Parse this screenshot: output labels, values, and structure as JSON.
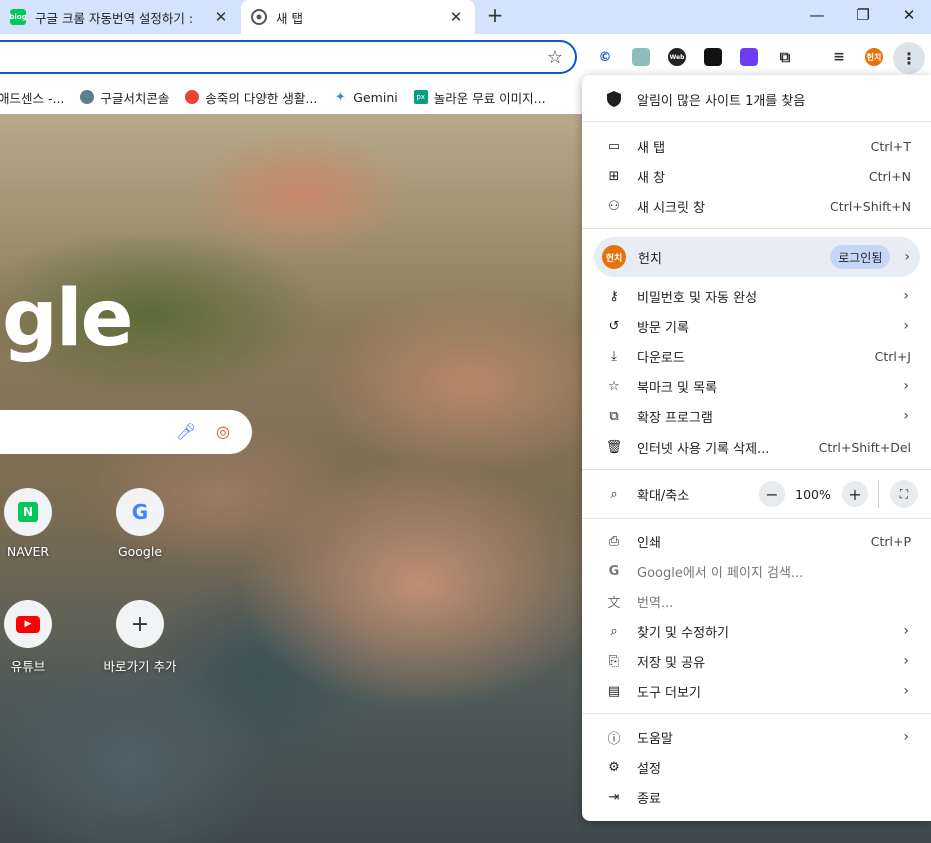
{
  "tabs": [
    {
      "title": "구글 크롬 자동번역 설정하기 :",
      "favicon_text": "blog",
      "active": false
    },
    {
      "title": "새 탭",
      "active": true
    }
  ],
  "window_controls": {
    "minimize": "—",
    "maximize": "❐",
    "close": "✕"
  },
  "bookmarks": [
    {
      "label": "애드센스 -...",
      "icon_color": "#f4b400"
    },
    {
      "label": "구글서치콘솔",
      "icon_color": "#607d8b"
    },
    {
      "label": "송죽의 다양한 생활...",
      "icon_color": "#ea4335"
    },
    {
      "label": "Gemini",
      "icon_color": "#4285f4"
    },
    {
      "label": "놀라운 무료 이미지...",
      "icon_color": "#05a081"
    }
  ],
  "ntp": {
    "logo_partial": "gle",
    "shortcuts": [
      {
        "label": "NAVER",
        "glyph": "N",
        "color": "#03c75a"
      },
      {
        "label": "Google",
        "glyph": "G",
        "color": "#4285f4"
      },
      {
        "label": "유튜브",
        "glyph": "▶",
        "color": "#ff0000"
      },
      {
        "label": "바로가기 추가",
        "glyph": "+",
        "color": "#333333"
      }
    ]
  },
  "profile_avatar": "헌치",
  "menu": {
    "safety_notice": "알림이 많은 사이트 1개를 찾음",
    "new_tab": {
      "label": "새 탭",
      "shortcut": "Ctrl+T"
    },
    "new_window": {
      "label": "새 창",
      "shortcut": "Ctrl+N"
    },
    "incognito": {
      "label": "새 시크릿 창",
      "shortcut": "Ctrl+Shift+N"
    },
    "profile": {
      "name": "헌치",
      "signin": "로그인됨"
    },
    "passwords": {
      "label": "비밀번호 및 자동 완성"
    },
    "history": {
      "label": "방문 기록"
    },
    "downloads": {
      "label": "다운로드",
      "shortcut": "Ctrl+J"
    },
    "bookmarks": {
      "label": "북마크 및 목록"
    },
    "extensions": {
      "label": "확장 프로그램"
    },
    "clear_data": {
      "label": "인터넷 사용 기록 삭제...",
      "shortcut": "Ctrl+Shift+Del"
    },
    "zoom": {
      "label": "확대/축소",
      "value": "100%",
      "minus": "−",
      "plus": "+"
    },
    "print": {
      "label": "인쇄",
      "shortcut": "Ctrl+P"
    },
    "search_page": {
      "label": "Google에서 이 페이지 검색..."
    },
    "translate": {
      "label": "번역..."
    },
    "find_edit": {
      "label": "찾기 및 수정하기"
    },
    "save_share": {
      "label": "저장 및 공유"
    },
    "more_tools": {
      "label": "도구 더보기"
    },
    "help": {
      "label": "도움말"
    },
    "settings": {
      "label": "설정"
    },
    "exit": {
      "label": "종료"
    }
  }
}
